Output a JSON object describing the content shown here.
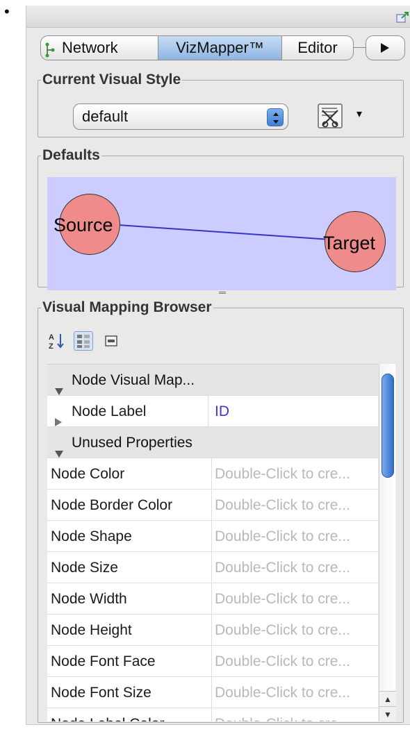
{
  "bullet": "•",
  "tabs": [
    {
      "label": "Network"
    },
    {
      "label": "VizMapper™"
    },
    {
      "label": "Editor"
    }
  ],
  "current_visual_style": {
    "title": "Current Visual Style",
    "selected": "default"
  },
  "defaults": {
    "title": "Defaults",
    "source_label": "Source",
    "target_label": "Target",
    "node_color": "#f08b8b",
    "edge_color": "#3333cc",
    "background_color": "#ccccff"
  },
  "mapping_browser": {
    "title": "Visual Mapping Browser",
    "categories": {
      "node_visual_mapping": "Node Visual Map...",
      "unused_properties": "Unused Properties"
    },
    "mapped": [
      {
        "name": "Node Label",
        "value": "ID"
      }
    ],
    "unused_placeholder": "Double-Click to cre...",
    "unused": [
      {
        "name": "Node Color"
      },
      {
        "name": "Node Border Color"
      },
      {
        "name": "Node Shape"
      },
      {
        "name": "Node Size"
      },
      {
        "name": "Node Width"
      },
      {
        "name": "Node Height"
      },
      {
        "name": "Node Font Face"
      },
      {
        "name": "Node Font Size"
      },
      {
        "name": "Node Label Color"
      }
    ]
  }
}
